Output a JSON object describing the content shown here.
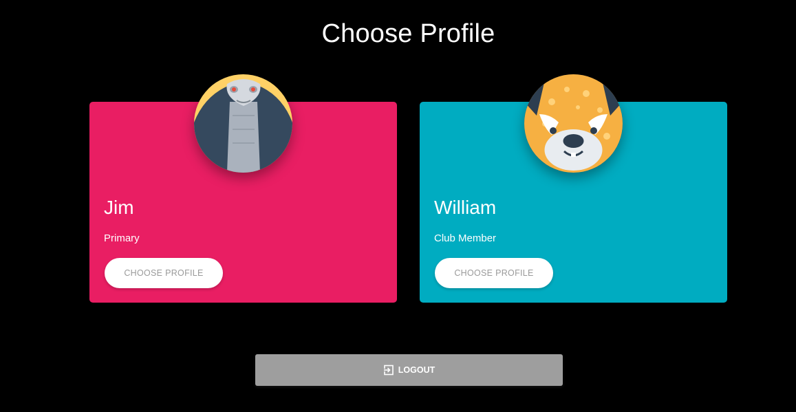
{
  "page": {
    "title": "Choose Profile"
  },
  "profiles": [
    {
      "name": "Jim",
      "role": "Primary",
      "button_label": "CHOOSE PROFILE",
      "color": "#e91e63",
      "avatar": "cobra-avatar"
    },
    {
      "name": "William",
      "role": "Club Member",
      "button_label": "CHOOSE PROFILE",
      "color": "#00acc1",
      "avatar": "leopard-avatar"
    }
  ],
  "logout": {
    "label": "LOGOUT",
    "icon": "logout-icon"
  }
}
